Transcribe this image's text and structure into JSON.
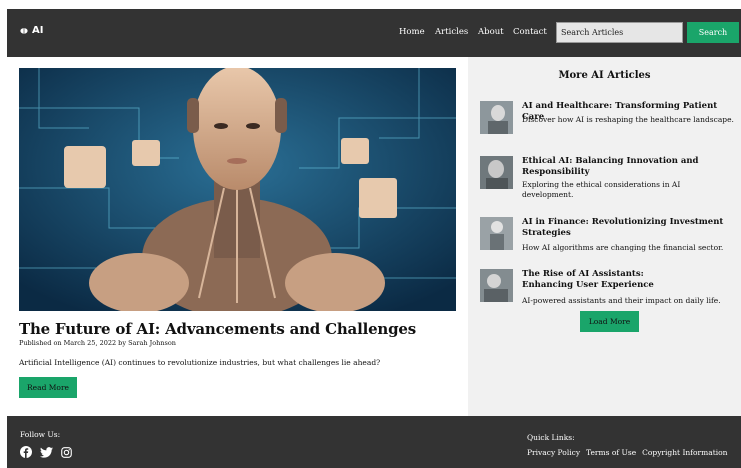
{
  "header": {
    "logo_text": "AI",
    "nav": [
      "Home",
      "Articles",
      "About",
      "Contact"
    ],
    "search_placeholder": "Search Articles",
    "search_button": "Search"
  },
  "main_article": {
    "title": "The Future of AI: Advancements and Challenges",
    "meta": "Published on March 25, 2022 by Sarah Johnson",
    "summary": "Artificial Intelligence (AI) continues to revolutionize industries, but what challenges lie ahead?",
    "read_more": "Read More"
  },
  "sidebar": {
    "title": "More AI Articles",
    "items": [
      {
        "title": "AI and Healthcare: Transforming Patient Care",
        "desc": "Discover how AI is reshaping the healthcare landscape."
      },
      {
        "title": "Ethical AI: Balancing Innovation and Responsibility",
        "desc": "Exploring the ethical considerations in AI development."
      },
      {
        "title": "AI in Finance: Revolutionizing Investment Strategies",
        "desc": "How AI algorithms are changing the financial sector."
      },
      {
        "title": "The Rise of AI Assistants: Enhancing User Experience",
        "desc": "AI-powered assistants and their impact on daily life."
      }
    ],
    "load_more": "Load More"
  },
  "footer": {
    "follow_label": "Follow Us:",
    "social_icons": [
      "facebook-icon",
      "twitter-icon",
      "instagram-icon"
    ],
    "quick_links_label": "Quick Links:",
    "links": [
      "Privacy Policy",
      "Terms of Use",
      "Copyright Information"
    ]
  },
  "colors": {
    "header_bg": "#333333",
    "accent": "#1aa56a",
    "sidebar_bg": "#f1f1f1"
  }
}
